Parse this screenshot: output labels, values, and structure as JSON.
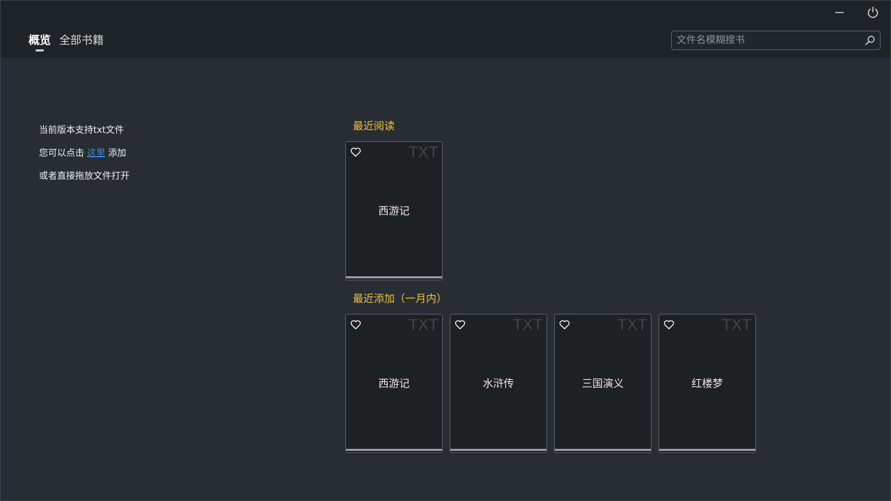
{
  "tabs": [
    {
      "label": "概览",
      "active": true
    },
    {
      "label": "全部书籍",
      "active": false
    }
  ],
  "search": {
    "placeholder": "文件名模糊搜书",
    "value": ""
  },
  "tips": {
    "line1": "当前版本支持txt文件",
    "line2_prefix": "您可以点击 ",
    "line2_link": "这里",
    "line2_suffix": " 添加",
    "line3": "或者直接拖放文件打开"
  },
  "recent_read": {
    "title": "最近阅读",
    "books": [
      {
        "title": "西游记",
        "type": "TXT"
      }
    ]
  },
  "recent_added": {
    "title": "最近添加（一月内）",
    "books": [
      {
        "title": "西游记",
        "type": "TXT"
      },
      {
        "title": "水浒传",
        "type": "TXT"
      },
      {
        "title": "三国演义",
        "type": "TXT"
      },
      {
        "title": "红楼梦",
        "type": "TXT"
      }
    ]
  },
  "icons": {
    "minimize": "minimize-icon",
    "power": "power-icon",
    "search": "search-icon",
    "favorite": "heart-icon"
  },
  "colors": {
    "accent": "#f0c33c",
    "link": "#3d8be0",
    "background": "#272d32",
    "topbar": "#1d2327"
  }
}
